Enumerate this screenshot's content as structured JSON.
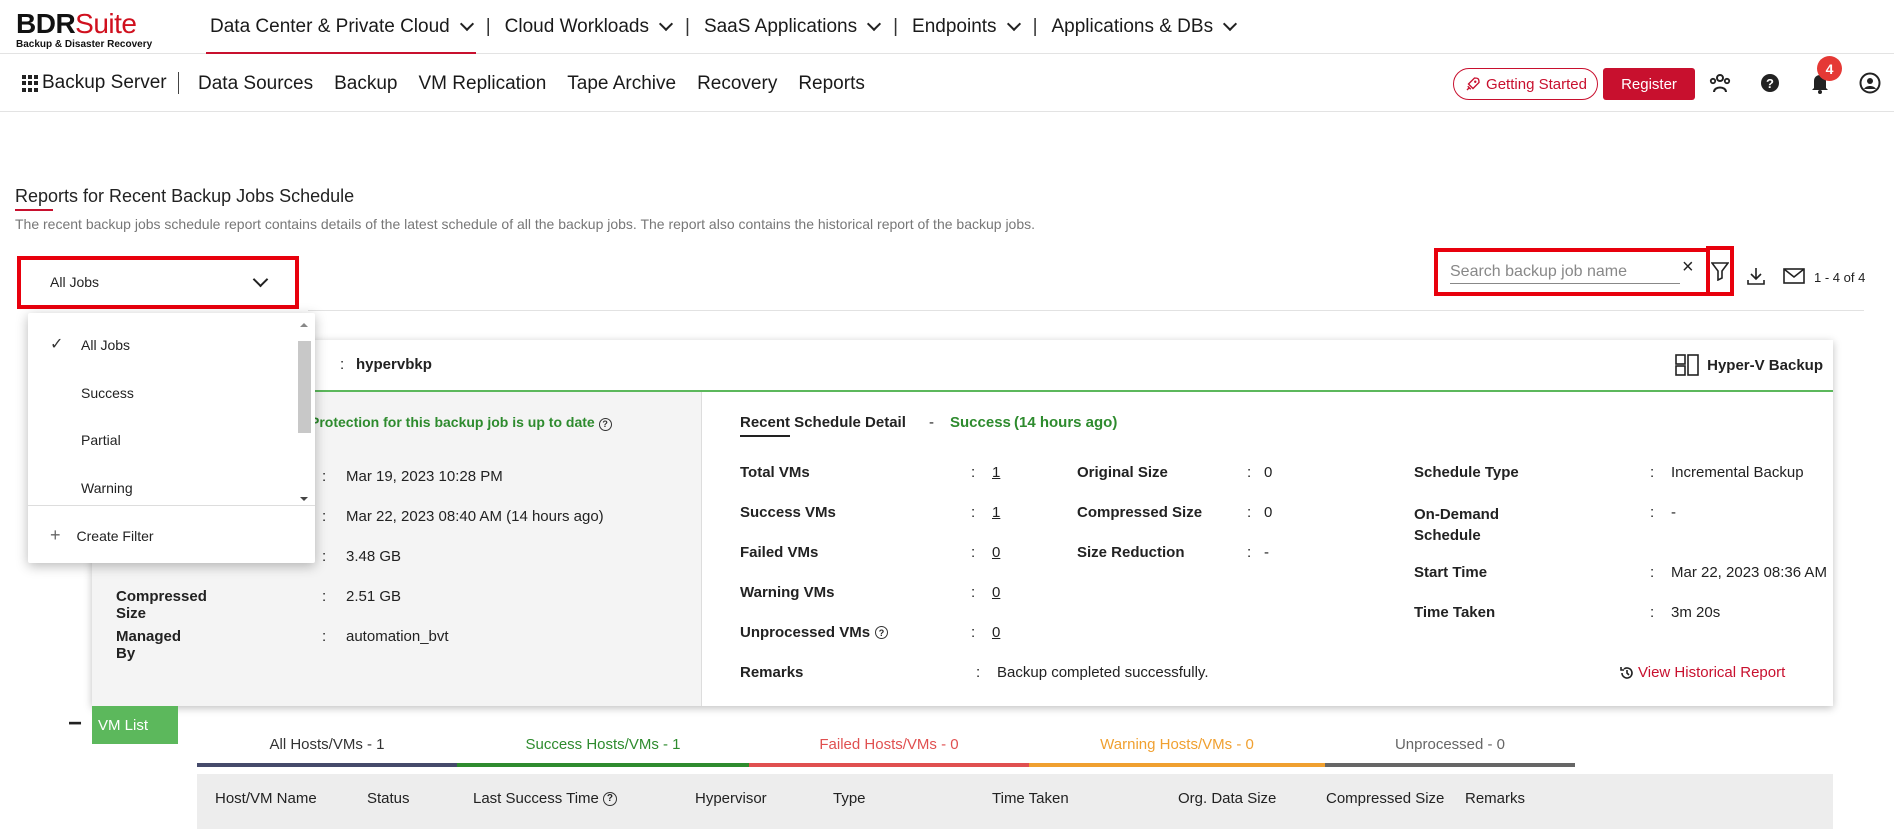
{
  "brand": {
    "name_part1": "BDR",
    "name_part2": "Suite",
    "tagline": "Backup & Disaster Recovery"
  },
  "topnav": [
    {
      "label": "Data Center & Private Cloud",
      "active": true
    },
    {
      "label": "Cloud Workloads"
    },
    {
      "label": "SaaS Applications"
    },
    {
      "label": "Endpoints"
    },
    {
      "label": "Applications & DBs"
    }
  ],
  "topnav_sep": "|",
  "subbar": {
    "title": "Backup Server",
    "items": [
      "Data Sources",
      "Backup",
      "VM Replication",
      "Tape Archive",
      "Recovery",
      "Reports"
    ],
    "getting_started": "Getting Started",
    "register": "Register",
    "notification_count": "4"
  },
  "page": {
    "title": "Reports for Recent Backup Jobs Schedule",
    "description": "The recent backup jobs schedule report contains details of the latest schedule of all the backup jobs. The report also contains the historical report of the backup jobs."
  },
  "filter": {
    "selected": "All Jobs",
    "options": [
      "All Jobs",
      "Success",
      "Partial",
      "Warning"
    ],
    "create_filter": "Create Filter"
  },
  "search": {
    "placeholder": "Search backup job name",
    "clear": "×",
    "pager": "1 - 4 of 4"
  },
  "card": {
    "colon": ":",
    "job_name": "hypervbkp",
    "job_type": "Hyper-V Backup",
    "protection_msg": "Protection for this backup job is up to date",
    "left_rows": [
      {
        "key": "",
        "value": "Mar 19, 2023 10:28 PM"
      },
      {
        "key": "",
        "value": "Mar 22, 2023 08:40 AM (14 hours ago)"
      },
      {
        "key": "",
        "value": "3.48 GB"
      },
      {
        "key": "Compressed Size",
        "value": "2.51 GB"
      },
      {
        "key": "Managed By",
        "value": "automation_bvt"
      }
    ],
    "recent": {
      "label": "Recent Schedule Detail",
      "dash": "-",
      "status": "Success",
      "ago": "(14 hours ago)"
    },
    "vm_stats": [
      {
        "key": "Total VMs",
        "value": "1"
      },
      {
        "key": "Success VMs",
        "value": "1"
      },
      {
        "key": "Failed VMs",
        "value": "0"
      },
      {
        "key": "Warning VMs",
        "value": "0"
      },
      {
        "key": "Unprocessed VMs",
        "value": "0"
      }
    ],
    "size_stats": [
      {
        "key": "Original Size",
        "value": "0"
      },
      {
        "key": "Compressed Size",
        "value": "0"
      },
      {
        "key": "Size Reduction",
        "value": "-"
      }
    ],
    "schedule_stats": [
      {
        "key": "Schedule Type",
        "value": "Incremental Backup"
      },
      {
        "key": "On-Demand Schedule",
        "value": "-"
      },
      {
        "key": "Start Time",
        "value": "Mar 22, 2023 08:36 AM"
      },
      {
        "key": "Time Taken",
        "value": "3m 20s"
      }
    ],
    "remarks_label": "Remarks",
    "remarks": "Backup completed successfully.",
    "view_history": "View Historical Report"
  },
  "vm_list": {
    "toggle": "−",
    "label": "VM List",
    "tabs": [
      {
        "label": "All Hosts/VMs - 1",
        "color": "#454a6b"
      },
      {
        "label": "Success Hosts/VMs - 1",
        "color": "#2e8b2e"
      },
      {
        "label": "Failed Hosts/VMs - 0",
        "color": "#e05050"
      },
      {
        "label": "Warning Hosts/VMs - 0",
        "color": "#f0a030"
      },
      {
        "label": "Unprocessed - 0",
        "color": "#666666"
      }
    ],
    "columns": [
      "Host/VM Name",
      "Status",
      "Last Success Time",
      "Hypervisor",
      "Type",
      "Time Taken",
      "Org. Data Size",
      "Compressed Size",
      "Remarks"
    ]
  }
}
